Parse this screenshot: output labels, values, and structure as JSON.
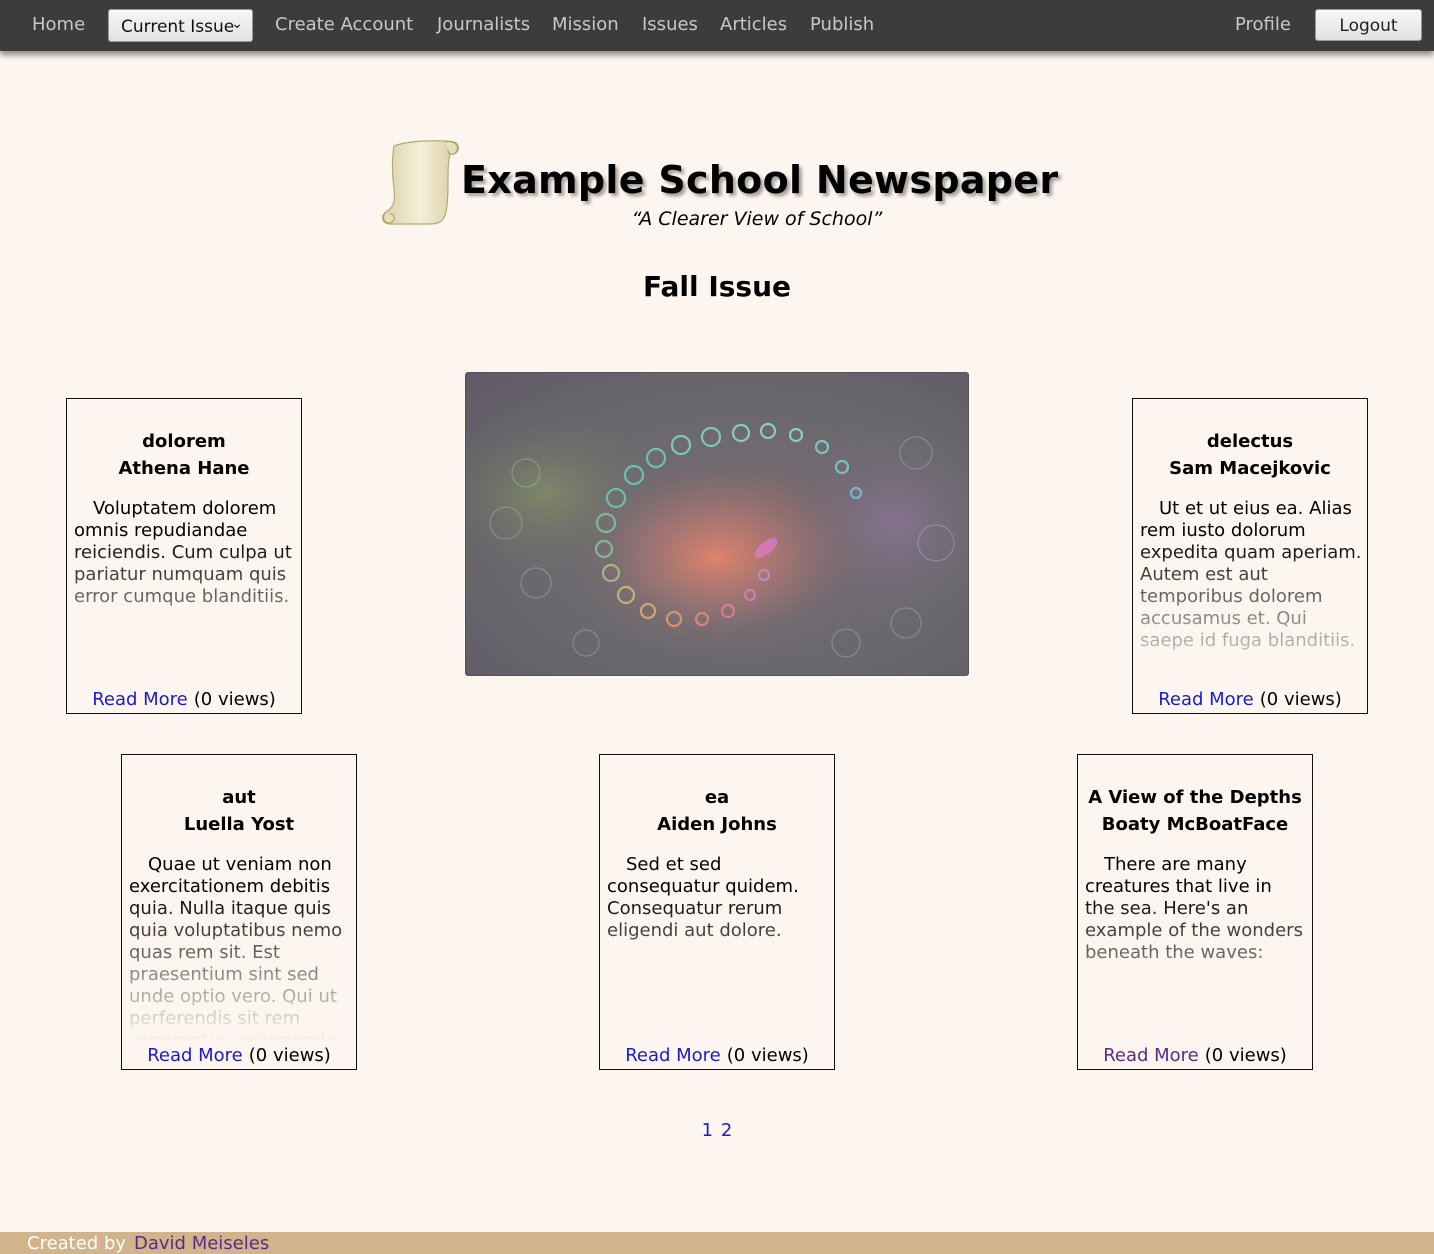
{
  "nav": {
    "home": "Home",
    "current_issue": "Current Issue",
    "create_account": "Create Account",
    "journalists": "Journalists",
    "mission": "Mission",
    "issues": "Issues",
    "articles": "Articles",
    "publish": "Publish",
    "profile": "Profile",
    "logout": "Logout"
  },
  "header": {
    "title": "Example School Newspaper",
    "tagline": "“A Clearer View of School”"
  },
  "issue": {
    "title": "Fall Issue"
  },
  "articles": [
    {
      "title": "dolorem",
      "author": "Athena Hane",
      "excerpt": "Voluptatem dolorem omnis repudiandae reiciendis. Cum culpa ut pariatur numquam quis error cumque blanditiis.",
      "read_more": "Read More",
      "views": "(0 views)"
    },
    {
      "title": "delectus",
      "author": "Sam Macejkovic",
      "excerpt": "Ut et ut eius ea. Alias rem iusto dolorum expedita quam aperiam. Autem est aut temporibus dolorem accusamus et. Qui saepe id fuga blanditiis.",
      "read_more": "Read More",
      "views": "(0 views)"
    },
    {
      "title": "aut",
      "author": "Luella Yost",
      "excerpt": "Quae ut veniam non exercitationem debitis quia. Nulla itaque quis quia voluptatibus nemo quas rem sit. Est praesentium sint sed unde optio vero. Qui ut perferendis sit rem aspernatur assumenda.",
      "read_more": "Read More",
      "views": "(0 views)"
    },
    {
      "title": "ea",
      "author": "Aiden Johns",
      "excerpt": "Sed et sed consequatur quidem. Consequatur rerum eligendi aut dolore.",
      "read_more": "Read More",
      "views": "(0 views)"
    },
    {
      "title": "A View of the Depths",
      "author": "Boaty McBoatFace",
      "excerpt": "There are many creatures that live in the sea. Here's an example of the wonders beneath the waves:",
      "read_more": "Read More",
      "views": "(0 views)"
    }
  ],
  "pagination": {
    "pages": [
      "1",
      "2"
    ]
  },
  "footer": {
    "label": "Created by",
    "author": "David Meiseles"
  },
  "colors": {
    "nav_background": "#3c3c3c",
    "page_background": "#fdf6f0",
    "footer_background": "#d1b48c",
    "link": "#1a1acd",
    "visited_link": "#5b2a86"
  }
}
